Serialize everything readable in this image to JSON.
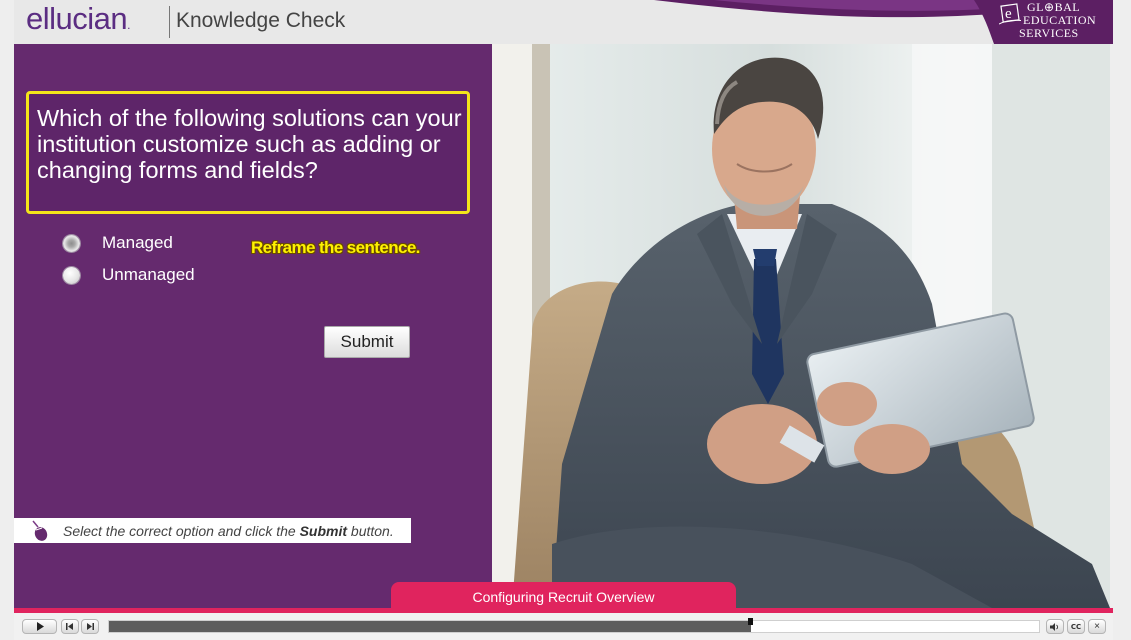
{
  "header": {
    "brand": "ellucian",
    "title": "Knowledge Check",
    "partner_logo": {
      "line1": "GL",
      "line1b": "BAL",
      "line2": "EDUCATION",
      "line3": "SERVICES",
      "letter": "e"
    }
  },
  "quiz": {
    "question": "Which of the following solutions can your institution customize such as adding or changing forms and fields?",
    "options": [
      {
        "label": "Managed",
        "selected": true
      },
      {
        "label": "Unmanaged",
        "selected": false
      }
    ],
    "annotation": "Reframe the sentence.",
    "submit_label": "Submit",
    "instruction": {
      "prefix": "Select the correct option and click the ",
      "emphasis": "Submit",
      "suffix": " button."
    }
  },
  "slide": {
    "title": "Configuring Recruit Overview"
  },
  "player": {
    "progress": 0.69,
    "icons": [
      "play-icon",
      "rewind-icon",
      "forward-icon",
      "volume-icon",
      "cc-icon",
      "close-icon"
    ],
    "cc_label": "CC"
  },
  "colors": {
    "panel": "#652a6e",
    "highlight": "#f4e61a",
    "accent": "#e0245e"
  }
}
